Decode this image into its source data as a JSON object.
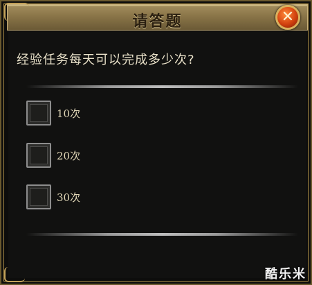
{
  "dialog": {
    "title": "请答题",
    "close_icon": "close-x-icon"
  },
  "question": {
    "text": "经验任务每天可以完成多少次?"
  },
  "options": [
    {
      "label": "10次",
      "checked": false
    },
    {
      "label": "20次",
      "checked": false
    },
    {
      "label": "30次",
      "checked": false
    }
  ],
  "watermark": "酷乐米",
  "colors": {
    "title_bar": "#8a7548",
    "close_button": "#d2410f",
    "frame_gold": "#a88b45",
    "text": "#e8e0c8"
  }
}
